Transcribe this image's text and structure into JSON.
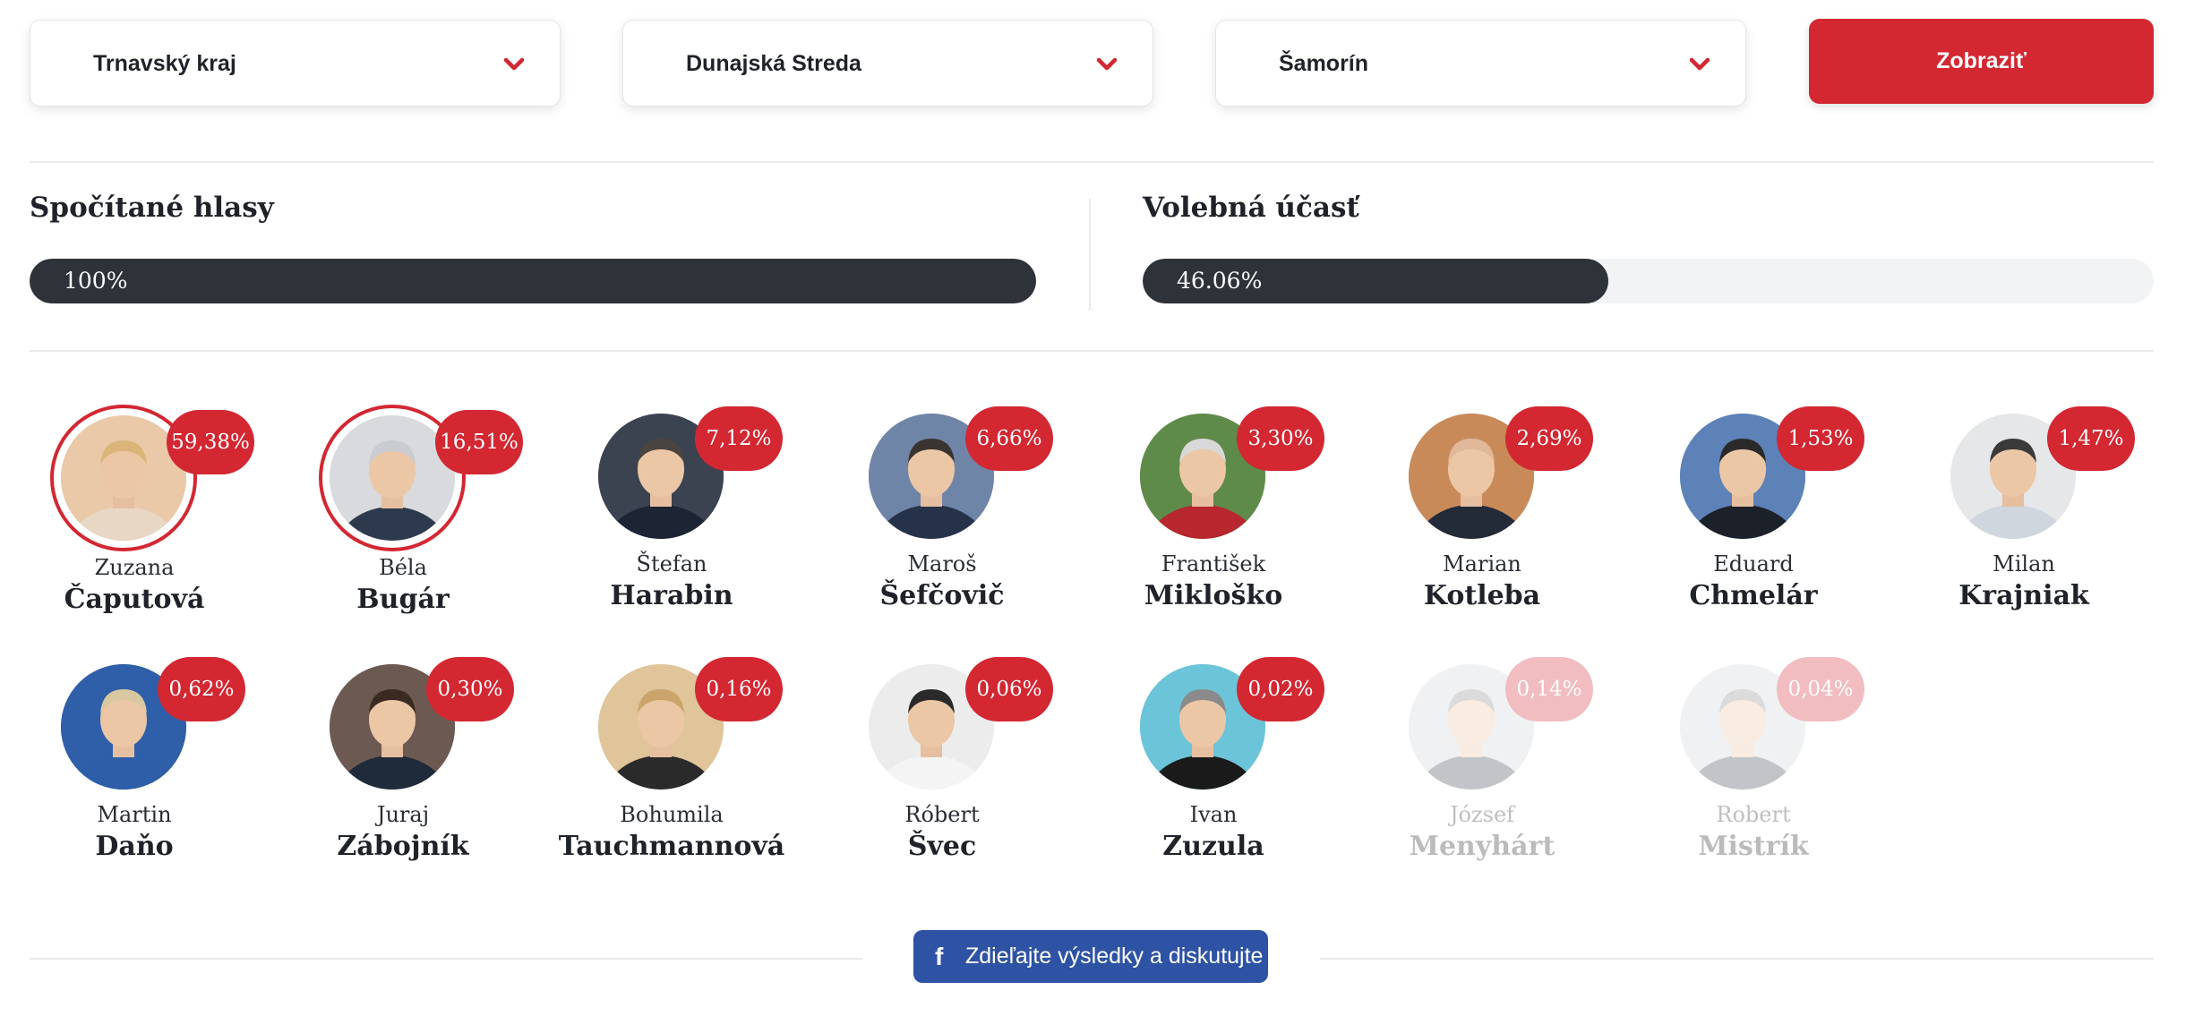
{
  "filters": {
    "region": "Trnavský kraj",
    "district": "Dunajská Streda",
    "municipality": "Šamorín",
    "show_label": "Zobraziť"
  },
  "stats": {
    "counted": {
      "title": "Spočítané hlasy",
      "value_label": "100%",
      "fraction": 1.0
    },
    "turnout": {
      "title": "Volebná účasť",
      "value_label": "46.06%",
      "fraction": 0.4606
    }
  },
  "colors": {
    "accent": "#d32732",
    "dark_bar": "#2e3339",
    "share": "#2f53a4"
  },
  "candidates": [
    {
      "first": "Zuzana",
      "last": "Čaputová",
      "percent": "59,38%",
      "highlight": true,
      "faded": false,
      "avatar_color": "#e9c9a8",
      "hair": "#d9b57a",
      "suit": "#e8d7c4"
    },
    {
      "first": "Béla",
      "last": "Bugár",
      "percent": "16,51%",
      "highlight": true,
      "faded": false,
      "avatar_color": "#d8dadd",
      "hair": "#c9ccd0",
      "suit": "#2d3a4d"
    },
    {
      "first": "Štefan",
      "last": "Harabin",
      "percent": "7,12%",
      "highlight": false,
      "faded": false,
      "avatar_color": "#3b4250",
      "hair": "#4a4440",
      "suit": "#1d2433"
    },
    {
      "first": "Maroš",
      "last": "Šefčovič",
      "percent": "6,66%",
      "highlight": false,
      "faded": false,
      "avatar_color": "#6f85a8",
      "hair": "#3a3430",
      "suit": "#26324a"
    },
    {
      "first": "František",
      "last": "Mikloško",
      "percent": "3,30%",
      "highlight": false,
      "faded": false,
      "avatar_color": "#5e8a4a",
      "hair": "#d8d8d8",
      "suit": "#b8262e"
    },
    {
      "first": "Marian",
      "last": "Kotleba",
      "percent": "2,69%",
      "highlight": false,
      "faded": false,
      "avatar_color": "#c98a5a",
      "hair": "#e0b89a",
      "suit": "#232a38"
    },
    {
      "first": "Eduard",
      "last": "Chmelár",
      "percent": "1,53%",
      "highlight": false,
      "faded": false,
      "avatar_color": "#5c82b8",
      "hair": "#2a2a2a",
      "suit": "#1c2028"
    },
    {
      "first": "Milan",
      "last": "Krajniak",
      "percent": "1,47%",
      "highlight": false,
      "faded": false,
      "avatar_color": "#e6e7e9",
      "hair": "#3a3a3a",
      "suit": "#cfd6de"
    },
    {
      "first": "Martin",
      "last": "Daňo",
      "percent": "0,62%",
      "highlight": false,
      "faded": false,
      "avatar_color": "#2f5fa8",
      "hair": "#d8c8a0",
      "suit": "#2e5ea8"
    },
    {
      "first": "Juraj",
      "last": "Zábojník",
      "percent": "0,30%",
      "highlight": false,
      "faded": false,
      "avatar_color": "#6c5a52",
      "hair": "#3a2a22",
      "suit": "#1f2a3a"
    },
    {
      "first": "Bohumila",
      "last": "Tauchmannová",
      "percent": "0,16%",
      "highlight": false,
      "faded": false,
      "avatar_color": "#e0c49a",
      "hair": "#caa46a",
      "suit": "#2a2a2a"
    },
    {
      "first": "Róbert",
      "last": "Švec",
      "percent": "0,06%",
      "highlight": false,
      "faded": false,
      "avatar_color": "#ececec",
      "hair": "#2a2a2a",
      "suit": "#f4f4f4"
    },
    {
      "first": "Ivan",
      "last": "Zuzula",
      "percent": "0,02%",
      "highlight": false,
      "faded": false,
      "avatar_color": "#6cc4d8",
      "hair": "#8a8a8a",
      "suit": "#1a1a1a"
    },
    {
      "first": "József",
      "last": "Menyhárt",
      "percent": "0,14%",
      "highlight": false,
      "faded": true,
      "avatar_color": "#cfd2d6",
      "hair": "#8a8a8a",
      "suit": "#3a3f48"
    },
    {
      "first": "Robert",
      "last": "Mistrík",
      "percent": "0,04%",
      "highlight": false,
      "faded": true,
      "avatar_color": "#cfd2d6",
      "hair": "#8a8a8a",
      "suit": "#3a3f48"
    }
  ],
  "share": {
    "label": "Zdieľajte výsledky a diskutujte",
    "icon": "facebook-icon"
  }
}
